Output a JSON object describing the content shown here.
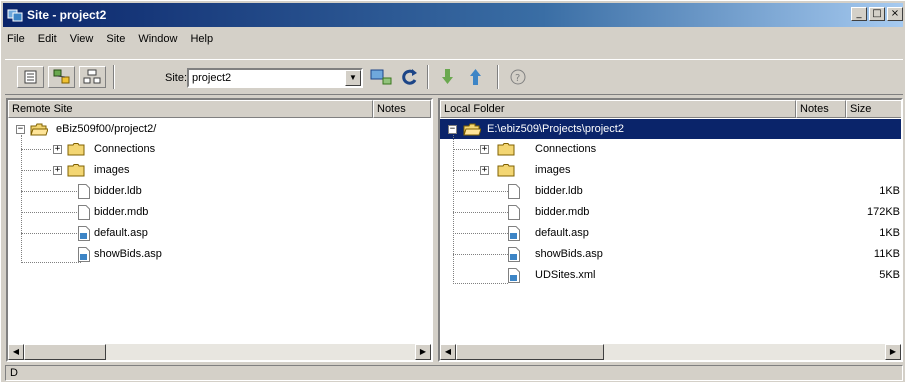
{
  "window": {
    "title": "Site - project2",
    "controls": [
      "_",
      "□",
      "×"
    ]
  },
  "menu": [
    "File",
    "Edit",
    "View",
    "Site",
    "Window",
    "Help"
  ],
  "toolbar": {
    "site_label": "Site:",
    "site_value": "project2"
  },
  "remote": {
    "header": {
      "name": "Remote Site",
      "notes": "Notes"
    },
    "root": "eBiz509f00/project2/",
    "items": [
      {
        "name": "Connections",
        "type": "folder"
      },
      {
        "name": "images",
        "type": "folder"
      },
      {
        "name": "bidder.ldb",
        "type": "file"
      },
      {
        "name": "bidder.mdb",
        "type": "file"
      },
      {
        "name": "default.asp",
        "type": "asp"
      },
      {
        "name": "showBids.asp",
        "type": "asp"
      }
    ]
  },
  "local": {
    "header": {
      "name": "Local Folder",
      "notes": "Notes",
      "size": "Size"
    },
    "root": "E:\\ebiz509\\Projects\\project2",
    "items": [
      {
        "name": "Connections",
        "type": "folder",
        "size": ""
      },
      {
        "name": "images",
        "type": "folder",
        "size": ""
      },
      {
        "name": "bidder.ldb",
        "type": "file",
        "size": "1KB"
      },
      {
        "name": "bidder.mdb",
        "type": "file",
        "size": "172KB"
      },
      {
        "name": "default.asp",
        "type": "asp",
        "size": "1KB"
      },
      {
        "name": "showBids.asp",
        "type": "asp",
        "size": "11KB"
      },
      {
        "name": "UDSites.xml",
        "type": "asp",
        "size": "5KB"
      }
    ]
  },
  "status": "D",
  "colors": {
    "selection": "#0a246a",
    "face": "#d4d0c8",
    "folder": "#f3d673"
  }
}
